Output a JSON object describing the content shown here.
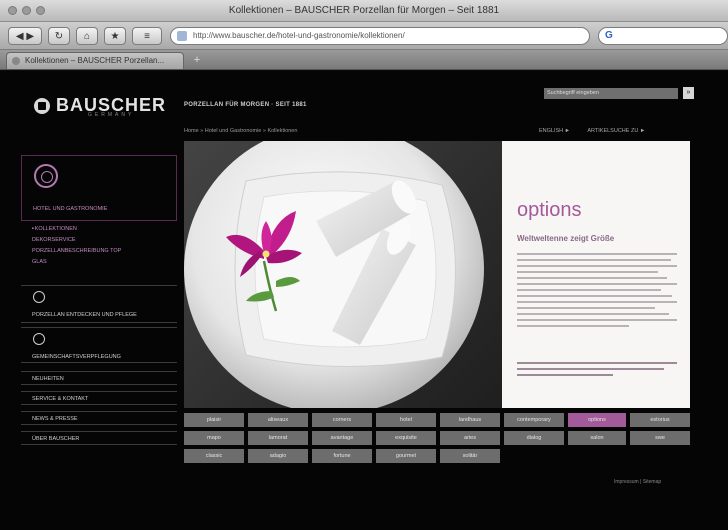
{
  "window": {
    "title": "Kollektionen – BAUSCHER Porzellan für Morgen – Seit 1881"
  },
  "browser": {
    "url": "http://www.bauscher.de/hotel-und-gastronomie/kollektionen/",
    "tab_label": "Kollektionen – BAUSCHER Porzellan...",
    "new_tab": "+",
    "search_icon_label": "G"
  },
  "header": {
    "brand": "BAUSCHER",
    "brand_sub": "GERMANY",
    "tagline": "PORZELLAN FÜR MORGEN · SEIT 1881",
    "search_placeholder": "Suchbegriff eingeben",
    "search_button": "»"
  },
  "breadcrumb": "Home  »  Hotel und Gastronomie  »  Kollektionen",
  "top_links": [
    "ENGLISH ►",
    "ARTIKELSUCHE ZU ►"
  ],
  "sidebar": {
    "hotel_label": "HOTEL UND GASTRONOMIE",
    "sub_items": [
      {
        "label": "KOLLEKTIONEN",
        "active": true
      },
      {
        "label": "DEKORSERVICE",
        "active": false
      },
      {
        "label": "PORZELLANBESCHREIBUNG TOP",
        "active": false
      },
      {
        "label": "GLAS",
        "active": false
      }
    ],
    "boxes": [
      {
        "label": "PORZELLAN ENTDECKEN UND PFLEGE"
      },
      {
        "label": "GEMEINSCHAFTSVERPFLEGUNG"
      }
    ],
    "items": [
      "NEUHEITEN",
      "SERVICE & KONTAKT",
      "NEWS & PRESSE",
      "ÜBER BAUSCHER"
    ]
  },
  "info": {
    "title": "options",
    "subtitle": "Weltweltenne zeigt Größe"
  },
  "product_grid": [
    [
      "plaisir",
      "aliseaux",
      "corners",
      "hotel",
      "landhaus",
      "contemporary",
      "options",
      "estorius"
    ],
    [
      "mapo",
      "lamorat",
      "avantage",
      "exquisite",
      "aries",
      "dialog",
      "salon",
      "swe"
    ],
    [
      "classic",
      "adagio",
      "fortune",
      "gourmet",
      "solitär"
    ]
  ],
  "active_product": "options",
  "footer_links": "Impressum | Sitemap"
}
